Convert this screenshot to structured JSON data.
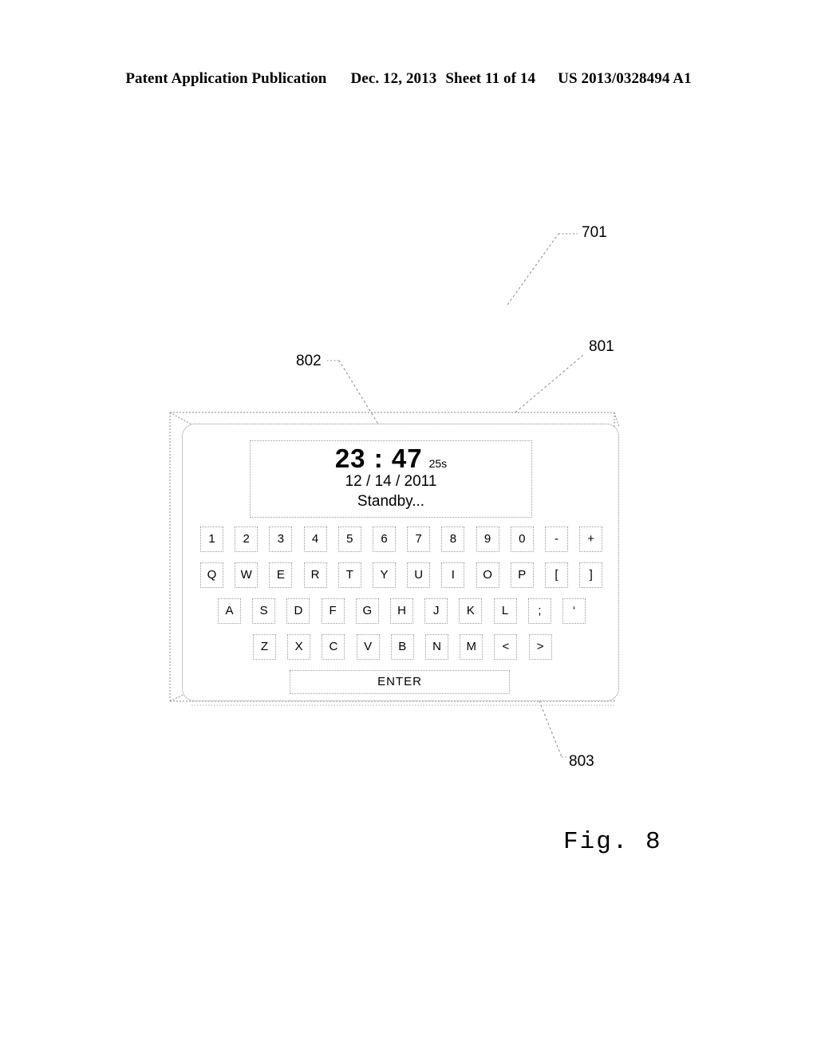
{
  "header": {
    "publication": "Patent Application Publication",
    "date": "Dec. 12, 2013",
    "sheet": "Sheet 11 of 14",
    "pub_number": "US 2013/0328494 A1"
  },
  "figure": {
    "caption": "Fig. 8",
    "reference_numerals": [
      {
        "id": "701",
        "label": "701"
      },
      {
        "id": "801",
        "label": "801"
      },
      {
        "id": "802",
        "label": "802"
      },
      {
        "id": "803",
        "label": "803"
      }
    ]
  },
  "device": {
    "display": {
      "time": "23 : 47",
      "seconds": "25s",
      "date": "12 / 14 / 2011",
      "status": "Standby..."
    },
    "keyboard": {
      "rows": [
        {
          "name": "number-row",
          "offset": 22,
          "keys": [
            "1",
            "2",
            "3",
            "4",
            "5",
            "6",
            "7",
            "8",
            "9",
            "0",
            "-",
            "+"
          ]
        },
        {
          "name": "qwerty-row",
          "offset": 22,
          "keys": [
            "Q",
            "W",
            "E",
            "R",
            "T",
            "Y",
            "U",
            "I",
            "O",
            "P",
            "[",
            "]"
          ]
        },
        {
          "name": "home-row",
          "offset": 44,
          "keys": [
            "A",
            "S",
            "D",
            "F",
            "G",
            "H",
            "J",
            "K",
            "L",
            ";",
            "‘"
          ]
        },
        {
          "name": "bottom-row",
          "offset": 88,
          "keys": [
            "Z",
            "X",
            "C",
            "V",
            "B",
            "N",
            "M",
            "<",
            ">"
          ]
        }
      ],
      "enter_label": "ENTER"
    }
  },
  "colors": {
    "line": "#8a8a8a",
    "key_border": "#9d9d9d",
    "text": "#000000",
    "background": "#ffffff"
  }
}
